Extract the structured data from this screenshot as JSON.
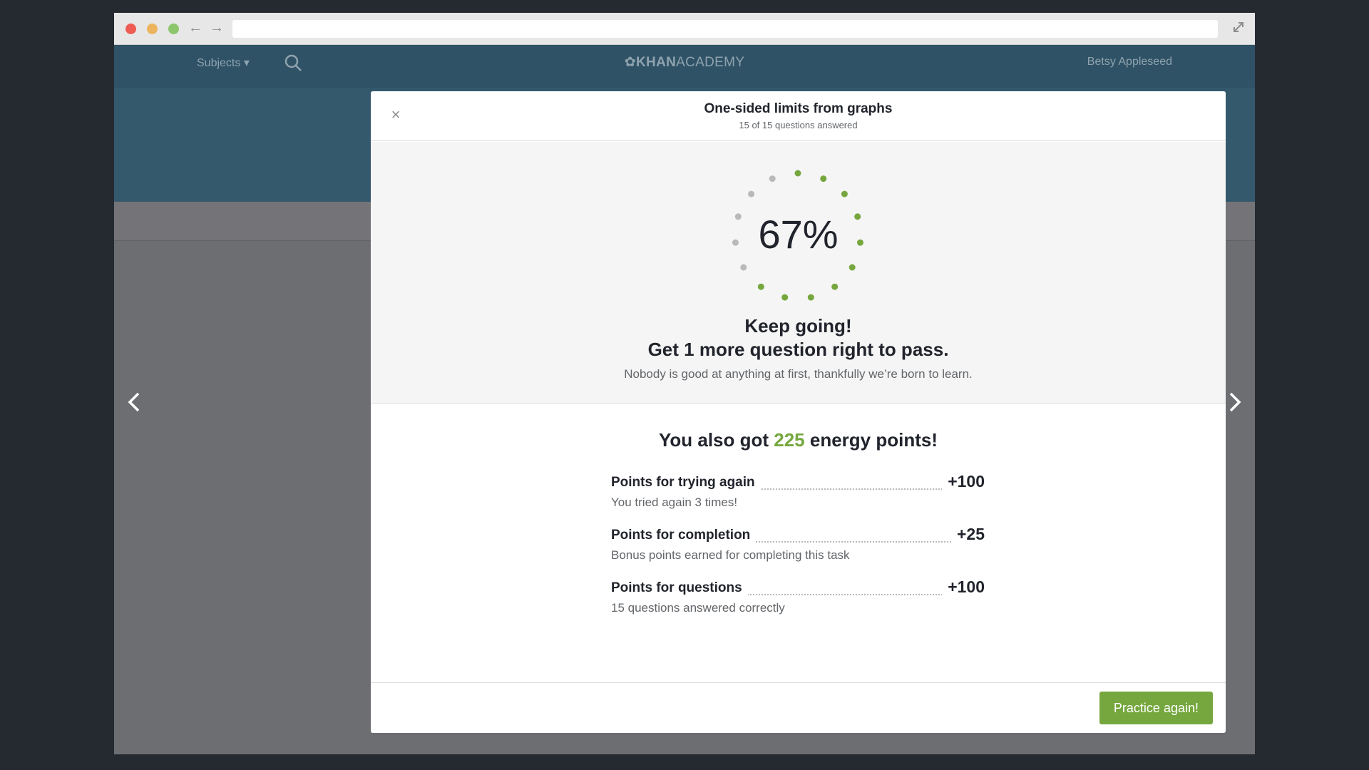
{
  "browser": {
    "url": "",
    "icons": [
      "back-arrow-icon",
      "forward-arrow-icon",
      "expand-icon"
    ]
  },
  "site": {
    "subjects_label": "Subjects",
    "logo_bold": "KHAN",
    "logo_light": "ACADEMY",
    "user_name": "Betsy Appleseed"
  },
  "modal": {
    "title": "One-sided limits from graphs",
    "subtitle": "15 of 15 questions answered",
    "close_symbol": "×"
  },
  "result": {
    "percent_label": "67%",
    "score_fraction": 0.67,
    "ring_dots_total": 15,
    "ring_dots_filled": 10,
    "headline": "Keep going!",
    "pass_message": "Get 1 more question right to pass.",
    "encouragement": "Nobody is good at anything at first, thankfully we’re born to learn."
  },
  "energy": {
    "prefix": "You also got ",
    "points": "225",
    "suffix": " energy points!",
    "items": [
      {
        "label": "Points for trying again",
        "value": "+100",
        "desc": "You tried again 3 times!"
      },
      {
        "label": "Points for completion",
        "value": "+25",
        "desc": "Bonus points earned for completing this task"
      },
      {
        "label": "Points for questions",
        "value": "+100",
        "desc": "15 questions answered correctly"
      }
    ]
  },
  "footer": {
    "practice_label": "Practice again!"
  },
  "colors": {
    "accent_green": "#76a73f",
    "ring_empty": "#b9b9b9",
    "header_teal": "#2f5266"
  }
}
